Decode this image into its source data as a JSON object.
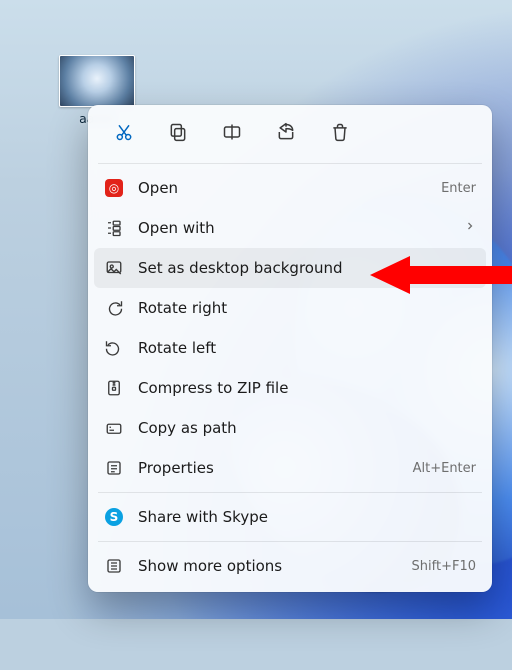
{
  "desktop": {
    "file_name": "aaron"
  },
  "context_menu": {
    "icon_row": {
      "cut": "cut-icon",
      "copy": "copy-icon",
      "rename": "rename-icon",
      "share": "share-icon",
      "delete": "delete-icon"
    },
    "items": [
      {
        "label": "Open",
        "accel": "Enter",
        "icon": "open-icon"
      },
      {
        "label": "Open with",
        "submenu": true,
        "icon": "open-with-icon"
      },
      {
        "label": "Set as desktop background",
        "icon": "set-background-icon",
        "highlight": true
      },
      {
        "label": "Rotate right",
        "icon": "rotate-right-icon"
      },
      {
        "label": "Rotate left",
        "icon": "rotate-left-icon"
      },
      {
        "label": "Compress to ZIP file",
        "icon": "compress-zip-icon"
      },
      {
        "label": "Copy as path",
        "icon": "copy-path-icon"
      },
      {
        "label": "Properties",
        "accel": "Alt+Enter",
        "icon": "properties-icon"
      }
    ],
    "extra_items": [
      {
        "label": "Share with Skype",
        "icon": "skype-icon"
      }
    ],
    "more_options": {
      "label": "Show more options",
      "accel": "Shift+F10",
      "icon": "more-options-icon"
    }
  },
  "annotation": {
    "target": "Set as desktop background"
  }
}
